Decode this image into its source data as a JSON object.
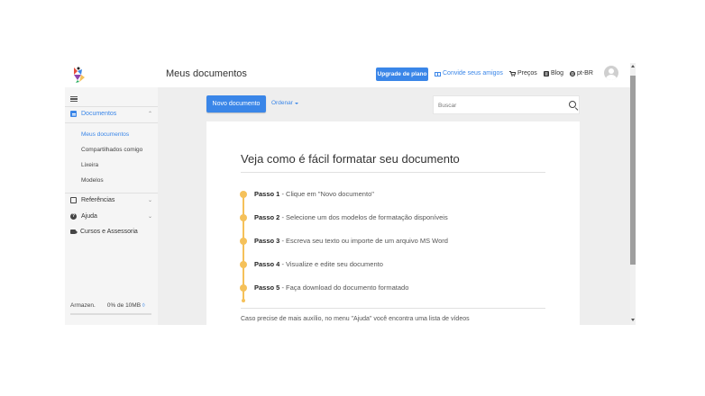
{
  "header": {
    "page_title": "Meus documentos",
    "upgrade_label": "Upgrade de plano",
    "invite_label": "Convide seus amigos",
    "prices_label": "Preços",
    "blog_label": "Blog",
    "lang_label": "pt-BR"
  },
  "sidebar": {
    "documents_label": "Documentos",
    "sub_items": [
      "Meus documentos",
      "Compartilhados comigo",
      "Lixeira",
      "Modelos"
    ],
    "references_label": "Referências",
    "help_label": "Ajuda",
    "courses_label": "Cursos e Assessoria",
    "storage_label": "Armazen.",
    "storage_value": "0% de 10MB",
    "storage_used_fraction": 0
  },
  "toolbar": {
    "new_document_label": "Novo documento",
    "order_label": "Ordenar",
    "search_placeholder": "Buscar"
  },
  "card": {
    "title": "Veja como é fácil formatar seu documento",
    "steps": [
      {
        "label": "Passo 1",
        "text": " - Clique em \"Novo documento\""
      },
      {
        "label": "Passo 2",
        "text": " - Selecione um dos modelos de formatação disponíveis"
      },
      {
        "label": "Passo 3",
        "text": " - Escreva seu texto ou importe de um arquivo MS Word"
      },
      {
        "label": "Passo 4",
        "text": " - Visualize e edite seu documento"
      },
      {
        "label": "Passo 5",
        "text": " - Faça download do documento formatado"
      }
    ],
    "footer": "Caso precise de mais auxílio, no menu \"Ajuda\" você encontra uma lista de vídeos"
  },
  "colors": {
    "accent": "#3a86e8",
    "timeline": "#f5c15a"
  }
}
